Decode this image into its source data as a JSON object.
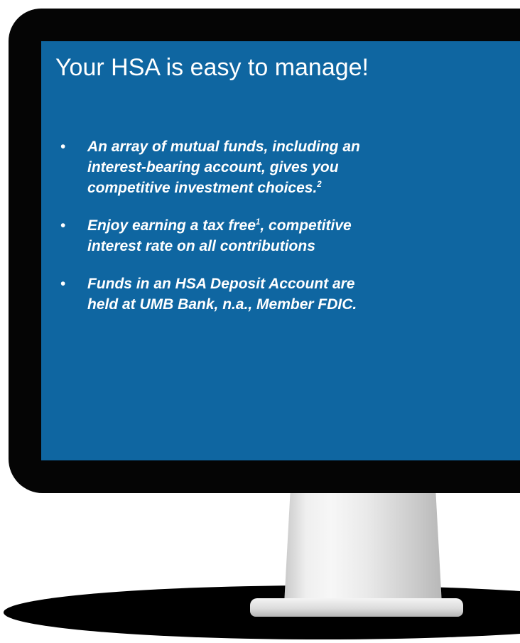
{
  "slide": {
    "title": "Your HSA is easy to manage!",
    "bullets": [
      {
        "text": "An array of mutual funds, including an\ninterest-bearing account, gives you\ncompetitive investment choices.",
        "superscript": "2"
      },
      {
        "text_before": "Enjoy earning a tax free",
        "superscript": "1",
        "text_after": ", competitive\ninterest rate on all contributions"
      },
      {
        "text": "Funds in an HSA Deposit Account are\nheld at UMB Bank, n.a., Member FDIC."
      }
    ],
    "bullet_symbol": "•"
  },
  "colors": {
    "screen_background": "#0f66a1",
    "bezel": "#050505",
    "text": "#ffffff",
    "stand": "#e6e6e6"
  },
  "icons": {
    "monitor": "desktop-monitor-icon"
  }
}
